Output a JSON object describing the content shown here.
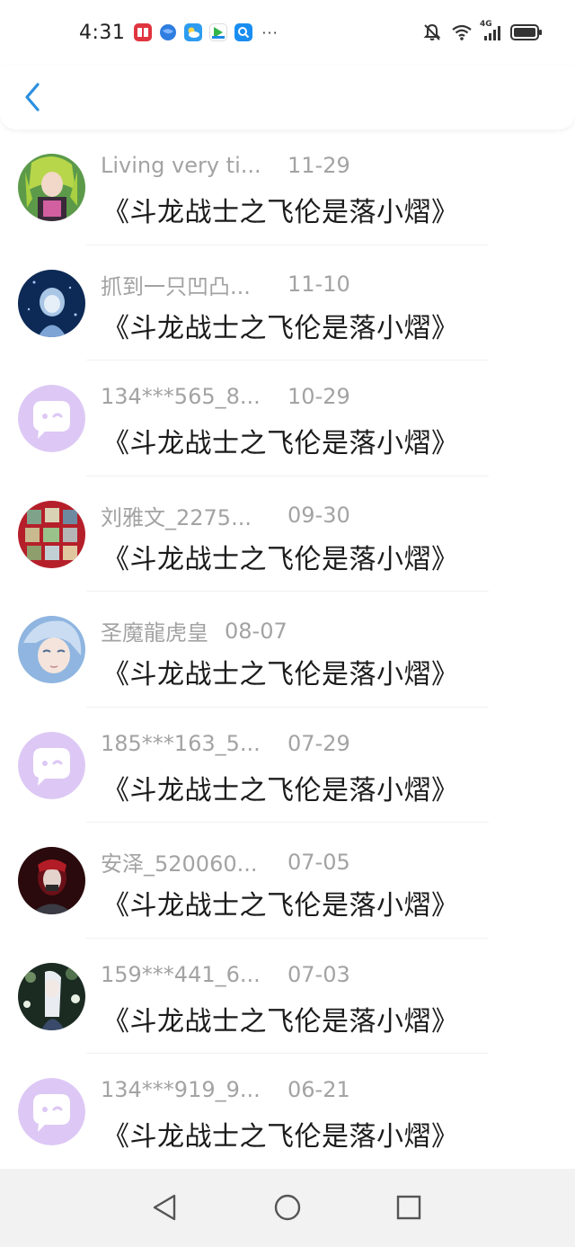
{
  "status_bar": {
    "time": "4:31",
    "more": "···",
    "network": "4G",
    "app_icons": [
      {
        "name": "red-book-app-icon",
        "color": "#e0343f"
      },
      {
        "name": "blue-ball-app-icon",
        "color": "#2f7de1"
      },
      {
        "name": "weather-app-icon",
        "color": "#2d9cf0"
      },
      {
        "name": "video-app-icon",
        "color": "#33b5e5"
      },
      {
        "name": "search-app-icon",
        "color": "#1a8df0"
      }
    ]
  },
  "header": {
    "back_icon": "chevron-left-icon"
  },
  "list": {
    "items": [
      {
        "name": "Living very ti...",
        "date": "11-29",
        "title": "《斗龙战士之飞伦是落小熠》",
        "avatar": "anime-green"
      },
      {
        "name": "抓到一只凹凸...",
        "date": "11-10",
        "title": "《斗龙战士之飞伦是落小熠》",
        "avatar": "anime-blue"
      },
      {
        "name": "134***565_8...",
        "date": "10-29",
        "title": "《斗龙战士之飞伦是落小熠》",
        "avatar": "default"
      },
      {
        "name": "刘雅文_2275...",
        "date": "09-30",
        "title": "《斗龙战士之飞伦是落小熠》",
        "avatar": "collage"
      },
      {
        "name": "圣魔龍虎皇",
        "date": "08-07",
        "title": "《斗龙战士之飞伦是落小熠》",
        "avatar": "anime-pale"
      },
      {
        "name": "185***163_5...",
        "date": "07-29",
        "title": "《斗龙战士之飞伦是落小熠》",
        "avatar": "default"
      },
      {
        "name": "安泽_520060...",
        "date": "07-05",
        "title": "《斗龙战士之飞伦是落小熠》",
        "avatar": "anime-dark"
      },
      {
        "name": "159***441_6...",
        "date": "07-03",
        "title": "《斗龙战士之飞伦是落小熠》",
        "avatar": "anime-white"
      },
      {
        "name": "134***919_9...",
        "date": "06-21",
        "title": "《斗龙战士之飞伦是落小熠》",
        "avatar": "default"
      }
    ]
  },
  "navbar": {
    "back": "triangle-back-icon",
    "home": "circle-home-icon",
    "recents": "square-recents-icon"
  },
  "colors": {
    "meta_text": "#a3a3a3",
    "title_text": "#1b1b1b",
    "accent": "#2a8fe0",
    "default_avatar": "#ddc8f5"
  }
}
